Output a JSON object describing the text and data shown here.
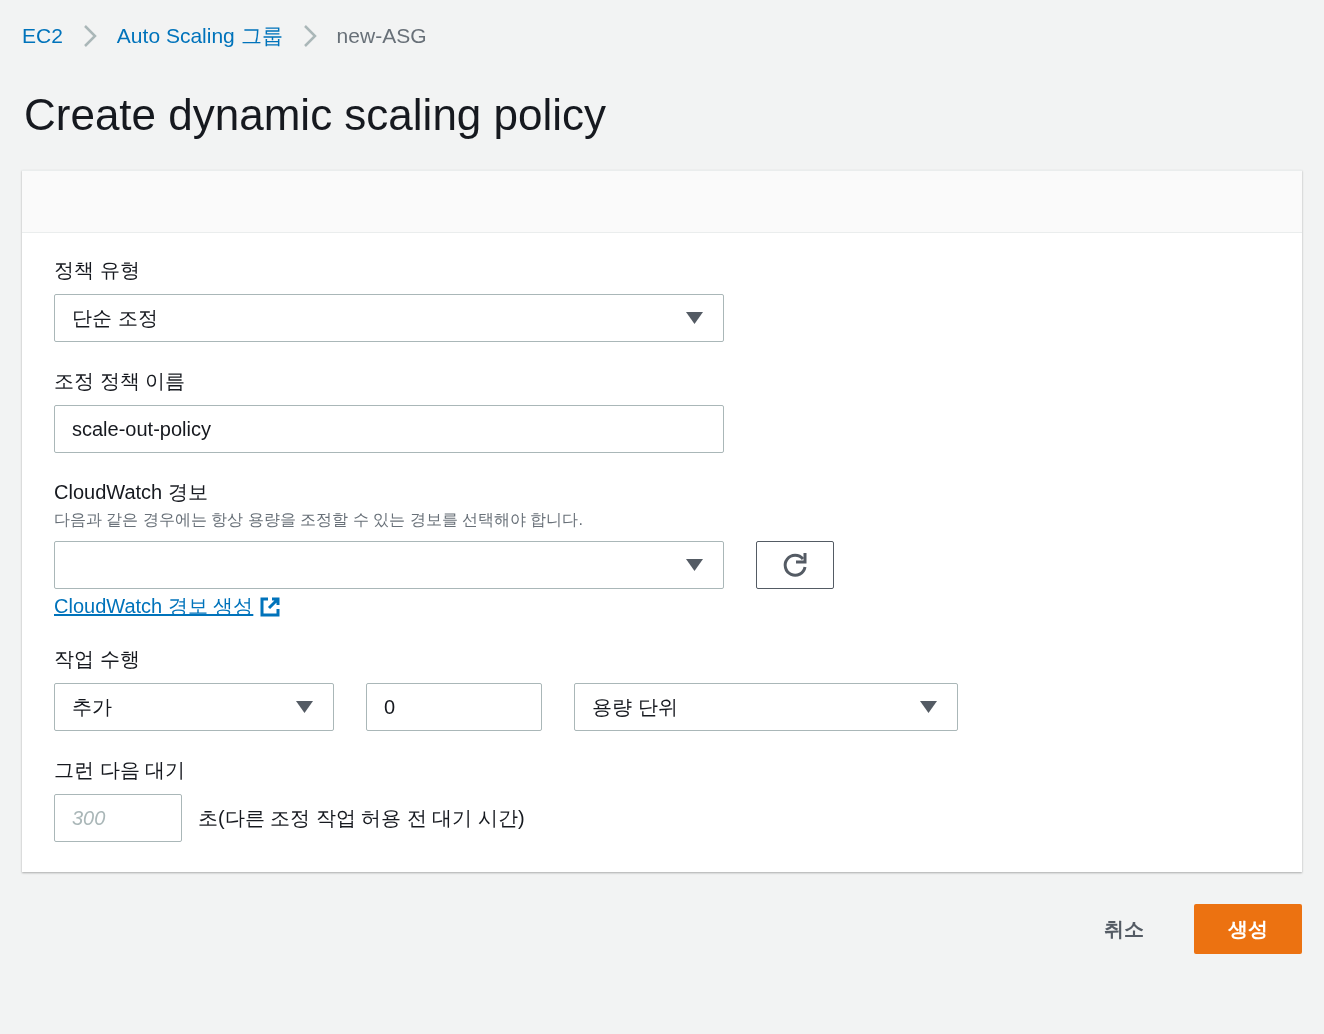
{
  "breadcrumb": [
    {
      "label": "EC2",
      "current": false
    },
    {
      "label": "Auto Scaling 그룹",
      "current": false
    },
    {
      "label": "new-ASG",
      "current": true
    }
  ],
  "title": "Create dynamic scaling policy",
  "policy_type": {
    "label": "정책 유형",
    "value": "단순 조정"
  },
  "policy_name": {
    "label": "조정 정책 이름",
    "value": "scale-out-policy"
  },
  "alarm": {
    "label": "CloudWatch 경보",
    "description": "다음과 같은 경우에는 항상 용량을 조정할 수 있는 경보를 선택해야 합니다.",
    "link": "CloudWatch 경보 생성"
  },
  "action": {
    "label": "작업 수행",
    "operation": "추가",
    "amount": "0",
    "unit": "용량 단위"
  },
  "wait": {
    "label": "그런 다음 대기",
    "placeholder": "300",
    "suffix": "초(다른 조정 작업 허용 전 대기 시간)"
  },
  "buttons": [
    {
      "label": "취소",
      "kind": "link"
    },
    {
      "label": "생성",
      "kind": "primary"
    }
  ]
}
